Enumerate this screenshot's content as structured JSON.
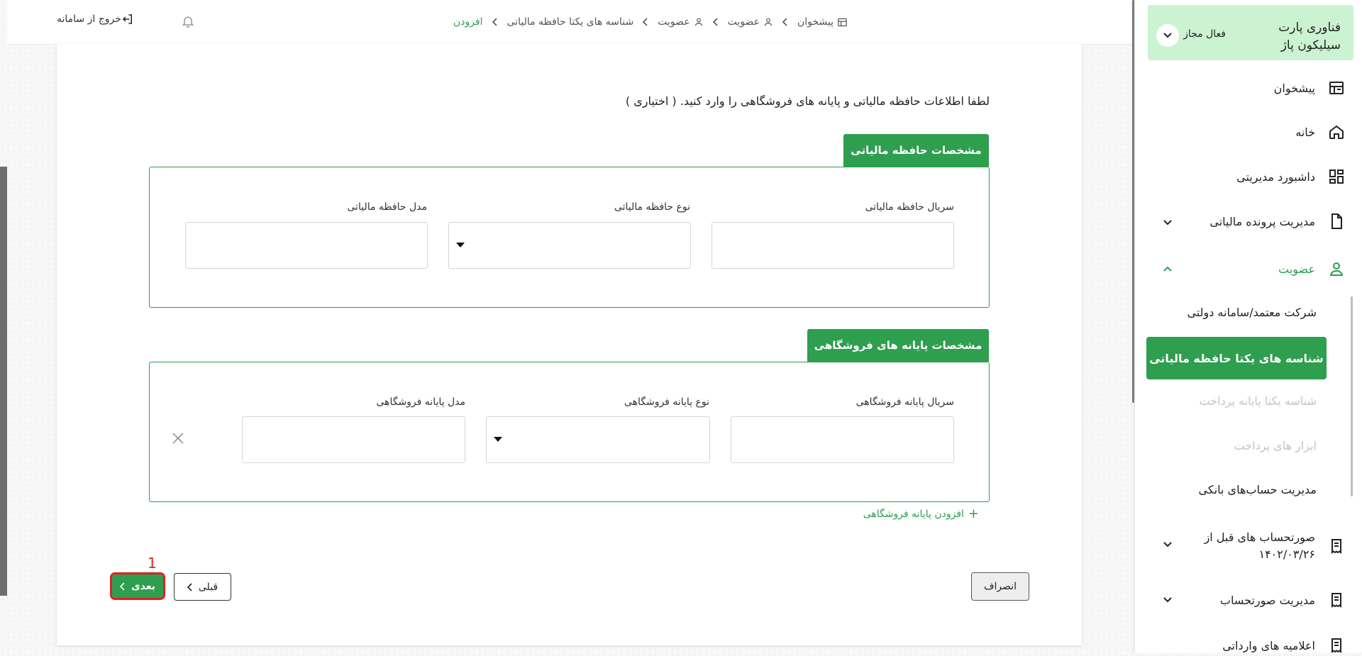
{
  "company": {
    "name": "فناوری پارت سیلیکون پاژ",
    "status": "فعال مجاز"
  },
  "sidebar": {
    "items": [
      {
        "label": "پیشخوان",
        "icon": "dashboard-icon"
      },
      {
        "label": "خانه",
        "icon": "home-icon"
      },
      {
        "label": "داشبورد مدیریتی",
        "icon": "grid-icon"
      },
      {
        "label": "مدیریت پرونده مالیاتی",
        "icon": "file-icon"
      },
      {
        "label": "عضویت",
        "icon": "user-icon",
        "active": true
      },
      {
        "label": "صورتحساب های قبل از ۱۴۰۲/۰۳/۲۶",
        "icon": "receipt-icon"
      },
      {
        "label": "مدیریت صورتحساب",
        "icon": "receipt-icon"
      },
      {
        "label": "اعلامیه های وارداتی",
        "icon": "receipt-icon"
      }
    ],
    "subitems": [
      {
        "label": "شرکت معتمد/سامانه دولتی"
      },
      {
        "label": "شناسه های یکتا حافظه مالیاتی",
        "active": true
      },
      {
        "label": "شناسه یکتا پایانه پرداخت",
        "disabled": true
      },
      {
        "label": "ابزار های پرداخت",
        "disabled": true
      },
      {
        "label": "مدیریت حساب‌های بانکی"
      }
    ]
  },
  "breadcrumb": [
    "پیشخوان",
    "عضویت",
    "عضویت",
    "شناسه های یکتا حافظه مالیاتی",
    "افزودن"
  ],
  "topbar": {
    "logout_label": "خروج از سامانه"
  },
  "main": {
    "hint": "لطفا اطلاعات حافظه مالیاتی و پایانه های فروشگاهی را وارد کنید. ( اختیاری )",
    "tax_memory": {
      "title": "مشخصات حافظه مالیاتی",
      "serial_label": "سریال حافظه مالیاتی",
      "type_label": "نوع حافظه مالیاتی",
      "model_label": "مدل حافظه مالیاتی"
    },
    "terminal": {
      "title": "مشخصات پایانه های فروشگاهی",
      "serial_label": "سریال پایانه فروشگاهی",
      "type_label": "نوع پایانه فروشگاهی",
      "model_label": "مدل پایانه فروشگاهی"
    },
    "add_terminal_label": "افزودن پایانه فروشگاهی",
    "buttons": {
      "cancel": "انصراف",
      "prev": "قبلی",
      "next": "بعدی"
    },
    "annotation": "1"
  },
  "colors": {
    "accent": "#2e9e4f",
    "accent_light": "#cbf3d2",
    "highlight": "#e02020"
  }
}
